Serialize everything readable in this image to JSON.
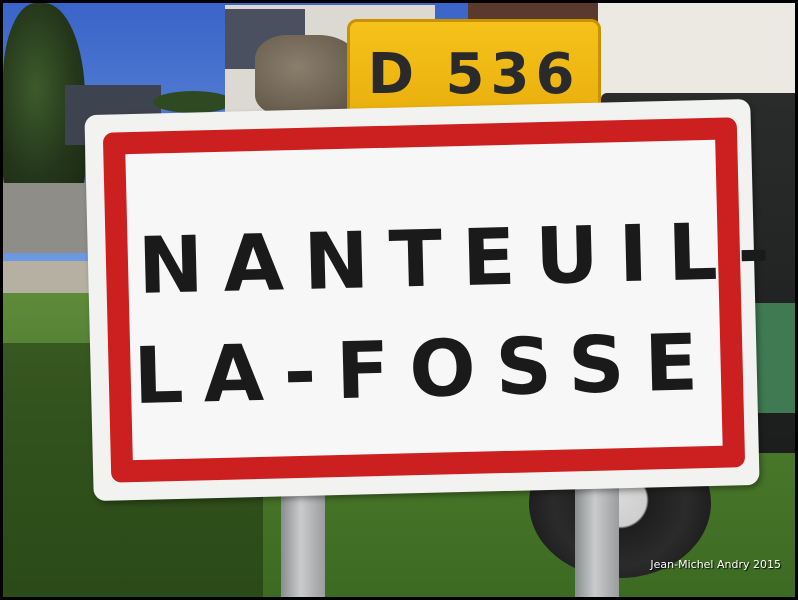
{
  "photo": {
    "road_plate": "D 536",
    "sign": {
      "line1": "NANTEUIL-",
      "line2": "LA-FOSSE"
    },
    "credit": "Jean-Michel Andry 2015"
  },
  "colors": {
    "sign_border": "#cc1f1f",
    "sign_face": "#f7f7f7",
    "road_plate": "#f2b915",
    "lettering": "#1a1a1a"
  }
}
